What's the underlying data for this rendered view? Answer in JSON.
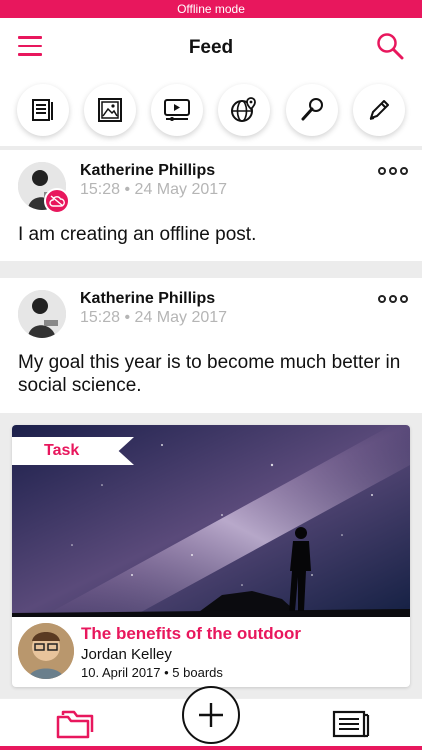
{
  "offline_banner": "Offline mode",
  "header": {
    "title": "Feed"
  },
  "quick_actions": [
    "text-post-icon",
    "image-icon",
    "video-icon",
    "globe-location-icon",
    "microphone-icon",
    "pencil-icon"
  ],
  "posts": [
    {
      "author": "Katherine Phillips",
      "time": "15:28",
      "date": "24 May 2017",
      "text": "I am creating an offline post.",
      "offline": true
    },
    {
      "author": "Katherine Phillips",
      "time": "15:28",
      "date": "24 May 2017",
      "text": "My goal this year is to become much better in social science.",
      "offline": false
    }
  ],
  "task": {
    "tag": "Task",
    "title": "The benefits of the outdoor",
    "author": "Jordan Kelley",
    "date": "10. April 2017",
    "boards": "5 boards"
  },
  "colors": {
    "accent": "#e8175d"
  }
}
